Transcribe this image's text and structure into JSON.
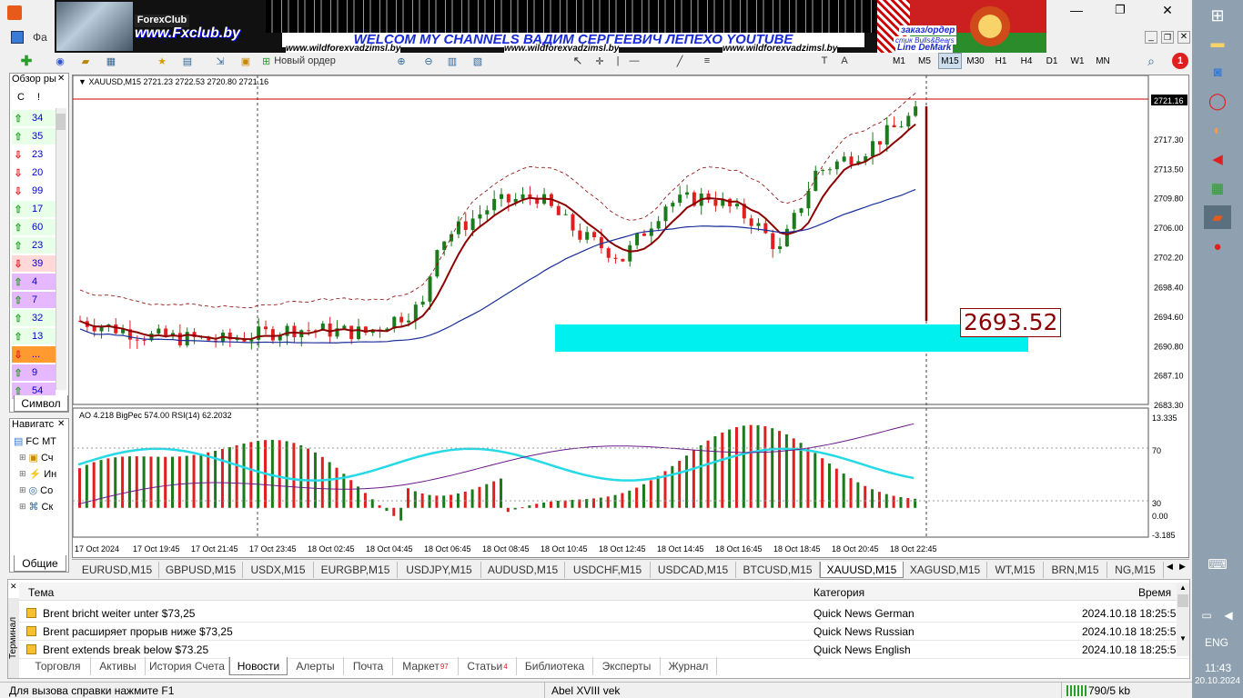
{
  "menu": {
    "file": "Фа"
  },
  "banner": {
    "logo": "ForexClub",
    "site": "www.Fxclub.by",
    "welcome": "WELCOM MY CHANNELS ВАДИМ СЕРГЕЕВИЧ ЛЕПЕХО YOUTUBE",
    "url1": "www.wildforexvadzimsl.by",
    "url2": "www.wildforexvadzimsl.by",
    "url3": "www.wildforexvadzimsl.by",
    "order": "заказ/ордер",
    "stick": "стик Bulls&Bears",
    "demark": "Line DeMark"
  },
  "toolbar": {
    "new_order": "Новый ордер",
    "timeframes": [
      "M1",
      "M5",
      "M15",
      "M30",
      "H1",
      "H4",
      "D1",
      "W1",
      "MN"
    ],
    "notif_count": "1"
  },
  "market_watch": {
    "title": "Обзор ры",
    "col_symbol": "С",
    "col_price": "!",
    "rows": [
      {
        "dir": "up",
        "val": "34",
        "bg": "#e8ffe8"
      },
      {
        "dir": "up",
        "val": "35",
        "bg": "#e8ffe8"
      },
      {
        "dir": "down",
        "val": "23",
        "bg": "#fff"
      },
      {
        "dir": "down",
        "val": "20",
        "bg": "#fff"
      },
      {
        "dir": "down",
        "val": "99",
        "bg": "#fff"
      },
      {
        "dir": "up",
        "val": "17",
        "bg": "#e8ffe8"
      },
      {
        "dir": "up",
        "val": "60",
        "bg": "#e8ffe8"
      },
      {
        "dir": "up",
        "val": "23",
        "bg": "#e8ffe8"
      },
      {
        "dir": "down",
        "val": "39",
        "bg": "#ffd8d8"
      },
      {
        "dir": "up",
        "val": "4",
        "bg": "#e6b8ff"
      },
      {
        "dir": "up",
        "val": "7",
        "bg": "#e6b8ff"
      },
      {
        "dir": "up",
        "val": "32",
        "bg": "#e8ffe8"
      },
      {
        "dir": "up",
        "val": "13",
        "bg": "#e8ffe8"
      },
      {
        "dir": "down",
        "val": "...",
        "bg": "#ff9a30"
      },
      {
        "dir": "up",
        "val": "9",
        "bg": "#e6b8ff"
      },
      {
        "dir": "up",
        "val": "54",
        "bg": "#e6b8ff"
      }
    ],
    "tab": "Символ"
  },
  "navigator": {
    "title": "Навигатс",
    "root": "FC MT",
    "items": [
      "Сч",
      "Ин",
      "Со",
      "Ск"
    ],
    "tab": "Общие"
  },
  "chart_header": {
    "symbol_line": "XAUUSD,M15  2721.23 2722.53 2720.80 2721.16",
    "indicator_line": "AO 4.218  BigPec 574.00  RSI(14) 62.2032"
  },
  "price_axis": [
    "2721.16",
    "2717.30",
    "2713.50",
    "2709.80",
    "2706.00",
    "2702.20",
    "2698.40",
    "2694.60",
    "2690.80",
    "2687.10",
    "2683.30"
  ],
  "sub_axis": [
    "13.335",
    "70",
    "30",
    "0.00",
    "-3.185"
  ],
  "time_axis": [
    "17 Oct 2024",
    "17 Oct 19:45",
    "17 Oct 21:45",
    "17 Oct 23:45",
    "18 Oct 02:45",
    "18 Oct 04:45",
    "18 Oct 06:45",
    "18 Oct 08:45",
    "18 Oct 10:45",
    "18 Oct 12:45",
    "18 Oct 14:45",
    "18 Oct 16:45",
    "18 Oct 18:45",
    "18 Oct 20:45",
    "18 Oct 22:45"
  ],
  "price_label": "2693.52",
  "colors": {
    "bull": "#1b7a1b",
    "bear": "#e02020",
    "ma_red": "#8b0000",
    "ma_blue": "#1a2f9a",
    "rsi": "#25d9e6",
    "ao_line": "#6a1a8a",
    "zone": "#00f0f0"
  },
  "symbol_tabs": [
    "EURUSD,M15",
    "GBPUSD,M15",
    "USDX,M15",
    "EURGBP,M15",
    "USDJPY,M15",
    "AUDUSD,M15",
    "USDCHF,M15",
    "USDCAD,M15",
    "BTCUSD,M15",
    "XAUUSD,M15",
    "XAGUSD,M15",
    "WT,M15",
    "BRN,M15",
    "NG,M15"
  ],
  "active_symbol_tab": 9,
  "terminal": {
    "side_label": "Терминал",
    "col_topic": "Тема",
    "col_category": "Категория",
    "col_time": "Время",
    "rows": [
      {
        "topic": "Brent bricht weiter unter $73,25",
        "category": "Quick News German",
        "time": "2024.10.18 18:25:55"
      },
      {
        "topic": "Brent расширяет прорыв ниже $73,25",
        "category": "Quick News Russian",
        "time": "2024.10.18 18:25:55"
      },
      {
        "topic": "Brent extends break below $73.25",
        "category": "Quick News English",
        "time": "2024.10.18 18:25:55"
      }
    ],
    "tabs": [
      {
        "label": "Торговля",
        "badge": ""
      },
      {
        "label": "Активы",
        "badge": ""
      },
      {
        "label": "История Счета",
        "badge": ""
      },
      {
        "label": "Новости",
        "badge": ""
      },
      {
        "label": "Алерты",
        "badge": ""
      },
      {
        "label": "Почта",
        "badge": ""
      },
      {
        "label": "Маркет",
        "badge": "97"
      },
      {
        "label": "Статьи",
        "badge": "4"
      },
      {
        "label": "Библиотека",
        "badge": ""
      },
      {
        "label": "Эксперты",
        "badge": ""
      },
      {
        "label": "Журнал",
        "badge": ""
      }
    ],
    "active_tab": 3
  },
  "status": {
    "help": "Для вызова справки нажмите F1",
    "profile": "Abel XVIII vek",
    "traffic": "790/5 kb"
  },
  "system": {
    "lang": "ENG",
    "time": "11:43",
    "date": "20.10.2024"
  }
}
